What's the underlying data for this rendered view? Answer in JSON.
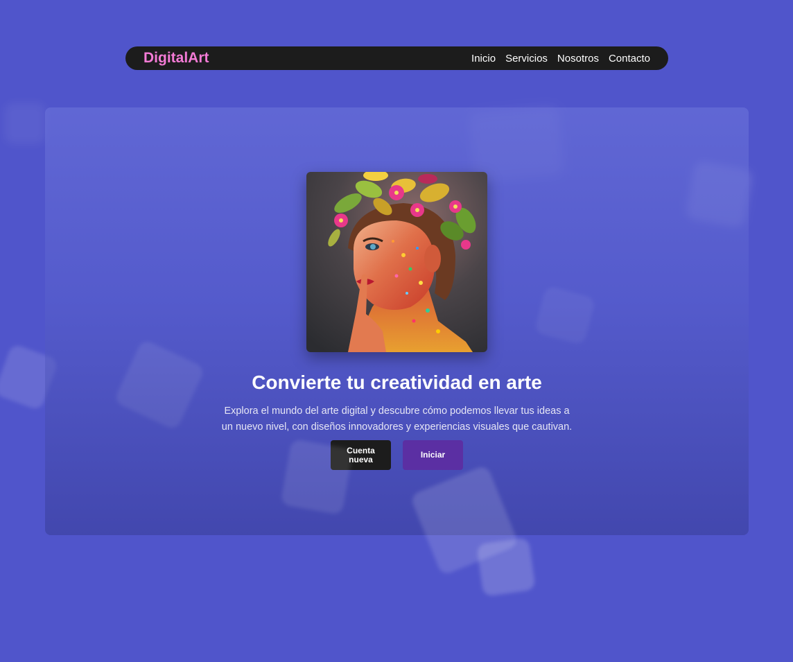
{
  "navbar": {
    "brand": "DigitalArt",
    "links": [
      "Inicio",
      "Servicios",
      "Nosotros",
      "Contacto"
    ]
  },
  "hero": {
    "title": "Convierte tu creatividad en arte",
    "description": "Explora el mundo del arte digital y descubre cómo podemos llevar tus ideas a un nuevo nivel, con diseños innovadores y experiencias visuales que cautivan.",
    "image": "woman-with-flower-crown-portrait",
    "buttons": {
      "new_account": "Cuenta nueva",
      "start": "Iniciar"
    }
  },
  "colors": {
    "background": "#5055cb",
    "navbar": "#1c1c1c",
    "brand": "#f47bd6",
    "button_dark": "#1c1c1c",
    "button_purple": "#5b2fa3"
  }
}
